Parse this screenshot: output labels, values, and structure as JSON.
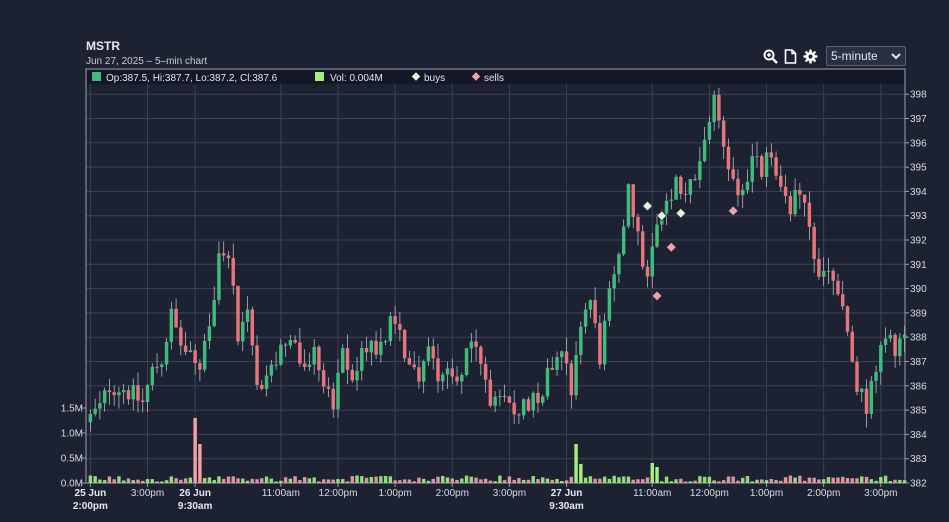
{
  "header": {
    "title": "MSTR",
    "subtitle": "Jun 27, 2025 – 5–min chart"
  },
  "toolbar": {
    "icons": [
      "zoom-icon",
      "document-icon",
      "gear-icon"
    ],
    "interval_selected": "5-minute"
  },
  "legend": {
    "ohlc_text": "Op:387.5, Hi:387.7, Lo:387.2, Cl:387.6",
    "vol_text": "Vol: 0.004M",
    "buys_label": "buys",
    "sells_label": "sells"
  },
  "colors": {
    "up": "#3ebd7a",
    "down": "#e8747c",
    "buy_marker": "#dff5d8",
    "sell_marker": "#f4a1a6",
    "vol_legend": "#a3f07a",
    "grid": "#3c4255",
    "background": "#1d2233"
  },
  "chart_data": {
    "type": "candlestick",
    "y_axis": {
      "min": 382,
      "max": 398.5,
      "ticks": [
        "382",
        "383",
        "384",
        "385",
        "386",
        "387",
        "388",
        "389",
        "390",
        "391",
        "392",
        "393",
        "394",
        "395",
        "396",
        "397",
        "398"
      ]
    },
    "volume_axis": {
      "unit": "M",
      "max": 2.0,
      "ticks": [
        "0.0M",
        "0.5M",
        "1.0M",
        "1.5M"
      ]
    },
    "x_ticks": [
      {
        "label": "25 Jun",
        "label2": "2:00pm",
        "bold": true,
        "index": 0
      },
      {
        "label": "3:00pm",
        "label2": "",
        "bold": false,
        "index": 12
      },
      {
        "label": "26 Jun",
        "label2": "9:30am",
        "bold": true,
        "index": 22
      },
      {
        "label": "11:00am",
        "label2": "",
        "bold": false,
        "index": 40
      },
      {
        "label": "12:00pm",
        "label2": "",
        "bold": false,
        "index": 52
      },
      {
        "label": "1:00pm",
        "label2": "",
        "bold": false,
        "index": 64
      },
      {
        "label": "2:00pm",
        "label2": "",
        "bold": false,
        "index": 76
      },
      {
        "label": "3:00pm",
        "label2": "",
        "bold": false,
        "index": 88
      },
      {
        "label": "27 Jun",
        "label2": "9:30am",
        "bold": true,
        "index": 100
      },
      {
        "label": "11:00am",
        "label2": "",
        "bold": false,
        "index": 118
      },
      {
        "label": "12:00pm",
        "label2": "",
        "bold": false,
        "index": 130
      },
      {
        "label": "1:00pm",
        "label2": "",
        "bold": false,
        "index": 142
      },
      {
        "label": "2:00pm",
        "label2": "",
        "bold": false,
        "index": 154
      },
      {
        "label": "3:00pm",
        "label2": "",
        "bold": false,
        "index": 166
      }
    ],
    "path": [
      [
        0,
        384.7
      ],
      [
        2,
        385.1
      ],
      [
        4,
        386.0
      ],
      [
        7,
        385.9
      ],
      [
        9,
        385.6
      ],
      [
        11,
        385.3
      ],
      [
        13,
        386.6
      ],
      [
        15,
        387.1
      ],
      [
        17,
        388.9
      ],
      [
        19,
        387.7
      ],
      [
        21,
        387.1
      ],
      [
        23,
        386.5
      ],
      [
        25,
        388.3
      ],
      [
        27,
        391.5
      ],
      [
        29,
        391.7
      ],
      [
        31,
        388.0
      ],
      [
        33,
        389.0
      ],
      [
        35,
        386.2
      ],
      [
        37,
        386.0
      ],
      [
        39,
        387.2
      ],
      [
        41,
        388.0
      ],
      [
        43,
        387.4
      ],
      [
        45,
        386.7
      ],
      [
        47,
        387.4
      ],
      [
        49,
        386.3
      ],
      [
        51,
        385.1
      ],
      [
        53,
        387.2
      ],
      [
        55,
        386.3
      ],
      [
        57,
        387.3
      ],
      [
        59,
        387.8
      ],
      [
        61,
        387.6
      ],
      [
        63,
        388.6
      ],
      [
        65,
        388.0
      ],
      [
        67,
        386.9
      ],
      [
        69,
        386.4
      ],
      [
        71,
        387.5
      ],
      [
        73,
        386.6
      ],
      [
        75,
        386.8
      ],
      [
        77,
        386.0
      ],
      [
        79,
        387.7
      ],
      [
        81,
        387.4
      ],
      [
        83,
        386.1
      ],
      [
        85,
        385.1
      ],
      [
        87,
        385.3
      ],
      [
        89,
        384.9
      ],
      [
        91,
        385.3
      ],
      [
        93,
        385.4
      ],
      [
        95,
        386.0
      ],
      [
        97,
        386.9
      ],
      [
        99,
        387.8
      ],
      [
        101,
        386.0
      ],
      [
        103,
        388.8
      ],
      [
        105,
        389.5
      ],
      [
        107,
        387.2
      ],
      [
        109,
        389.6
      ],
      [
        111,
        391.0
      ],
      [
        113,
        394.5
      ],
      [
        115,
        392.0
      ],
      [
        117,
        390.3
      ],
      [
        119,
        392.8
      ],
      [
        121,
        393.2
      ],
      [
        123,
        394.2
      ],
      [
        125,
        393.8
      ],
      [
        127,
        394.6
      ],
      [
        129,
        396.2
      ],
      [
        131,
        397.6
      ],
      [
        133,
        396.0
      ],
      [
        135,
        394.4
      ],
      [
        137,
        394.0
      ],
      [
        139,
        395.3
      ],
      [
        141,
        394.9
      ],
      [
        143,
        395.6
      ],
      [
        145,
        393.8
      ],
      [
        147,
        393.5
      ],
      [
        149,
        393.9
      ],
      [
        151,
        392.4
      ],
      [
        153,
        390.3
      ],
      [
        155,
        390.8
      ],
      [
        157,
        389.8
      ],
      [
        159,
        388.0
      ],
      [
        161,
        385.8
      ],
      [
        163,
        385.2
      ],
      [
        165,
        386.7
      ],
      [
        167,
        387.9
      ],
      [
        169,
        387.6
      ],
      [
        171,
        387.9
      ]
    ],
    "num_candles": 172,
    "volume_spikes": {
      "22": 1.3,
      "23": 0.78,
      "102": 0.78,
      "103": 0.38,
      "118": 0.4,
      "119": 0.32
    },
    "buys": [
      [
        117,
        393.4
      ],
      [
        120,
        393.0
      ],
      [
        124,
        393.1
      ]
    ],
    "sells": [
      [
        119,
        389.7
      ],
      [
        122,
        391.7
      ],
      [
        135,
        393.2
      ]
    ]
  }
}
